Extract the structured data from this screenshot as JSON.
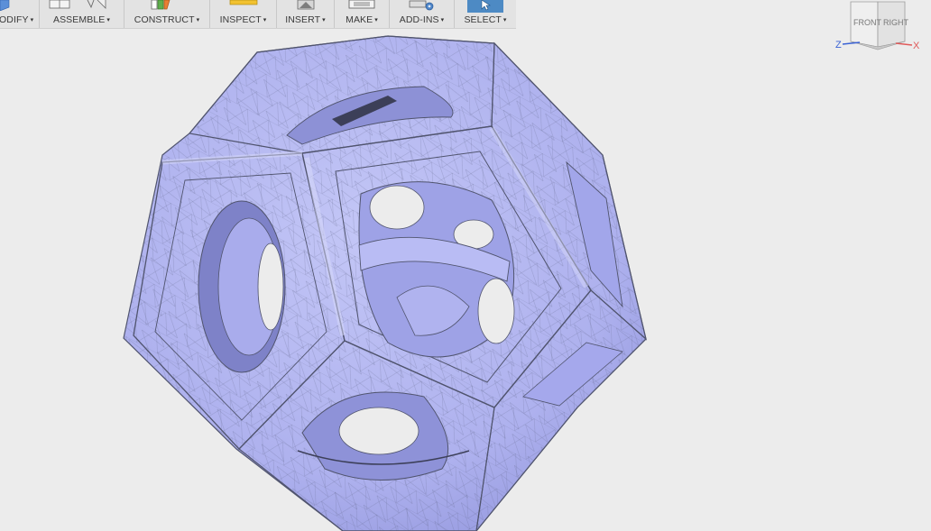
{
  "toolbar": {
    "groups": [
      {
        "label": "ODIFY",
        "icon": "modify-icon"
      },
      {
        "label": "ASSEMBLE",
        "icon": "assemble-icon"
      },
      {
        "label": "CONSTRUCT",
        "icon": "construct-icon"
      },
      {
        "label": "INSPECT",
        "icon": "inspect-icon"
      },
      {
        "label": "INSERT",
        "icon": "insert-icon"
      },
      {
        "label": "MAKE",
        "icon": "make-icon"
      },
      {
        "label": "ADD-INS",
        "icon": "addins-icon"
      },
      {
        "label": "SELECT",
        "icon": "select-cursor-icon",
        "active": true
      }
    ],
    "dropdown_glyph": "▾"
  },
  "viewcube": {
    "front_label": "FRONT",
    "right_label": "RIGHT",
    "axis_z": "Z",
    "axis_x": "X"
  },
  "colors": {
    "background": "#ececec",
    "toolbar": "#e3e3e3",
    "model_fill": "#b3b6f2",
    "model_shade": "#8e92dc",
    "model_edge": "#50546e",
    "select_active": "#4d8ac4",
    "axis_z": "#3a62d4",
    "axis_x": "#e05a5a"
  }
}
